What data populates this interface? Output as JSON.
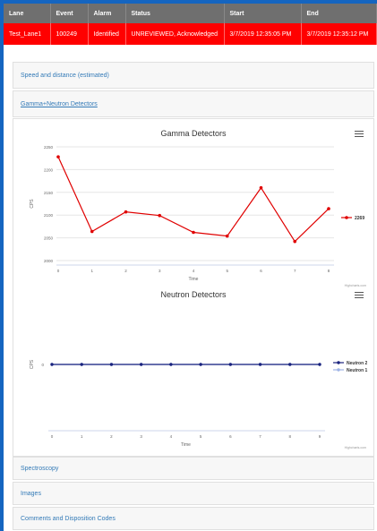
{
  "table": {
    "headers": [
      "Lane",
      "Event",
      "Alarm",
      "Status",
      "Start",
      "End"
    ],
    "row": [
      "Test_Lane1",
      "100249",
      "Identified",
      "UNREVIEWED, Acknowledged",
      "3/7/2019 12:35:05 PM",
      "3/7/2019 12:35:12 PM"
    ]
  },
  "sections": {
    "speed": "Speed and distance (estimated)",
    "gamma_neutron": "Gamma+Neutron Detectors",
    "spectroscopy": "Spectroscopy",
    "images": "Images",
    "comments": "Comments and Disposition Codes"
  },
  "credits": "Highcharts.com",
  "chart_data": [
    {
      "type": "line",
      "title": "Gamma Detectors",
      "xlabel": "Time",
      "ylabel": "CPS",
      "x": [
        0,
        1,
        2,
        3,
        4,
        5,
        6,
        7,
        8
      ],
      "y_ticks": [
        2000,
        2050,
        2100,
        2150,
        2200,
        2250
      ],
      "ylim": [
        2000,
        2250
      ],
      "series": [
        {
          "name": "2269",
          "color": "#e00000",
          "values": [
            2228,
            2064,
            2107,
            2099,
            2062,
            2054,
            2160,
            2042,
            2114
          ]
        }
      ],
      "legend": "right"
    },
    {
      "type": "line",
      "title": "Neutron Detectors",
      "xlabel": "Time",
      "ylabel": "CPS",
      "x": [
        0,
        1,
        2,
        3,
        4,
        5,
        6,
        7,
        8,
        9
      ],
      "y_ticks": [
        0
      ],
      "series": [
        {
          "name": "Neutron 2",
          "color": "#1a237e",
          "values": [
            0,
            0,
            0,
            0,
            0,
            0,
            0,
            0,
            0,
            0
          ]
        },
        {
          "name": "Neutron 1",
          "color": "#9fb4e6",
          "values": [
            0,
            0,
            0,
            0,
            0,
            0,
            0,
            0,
            0,
            0
          ]
        }
      ],
      "legend": "right"
    }
  ]
}
